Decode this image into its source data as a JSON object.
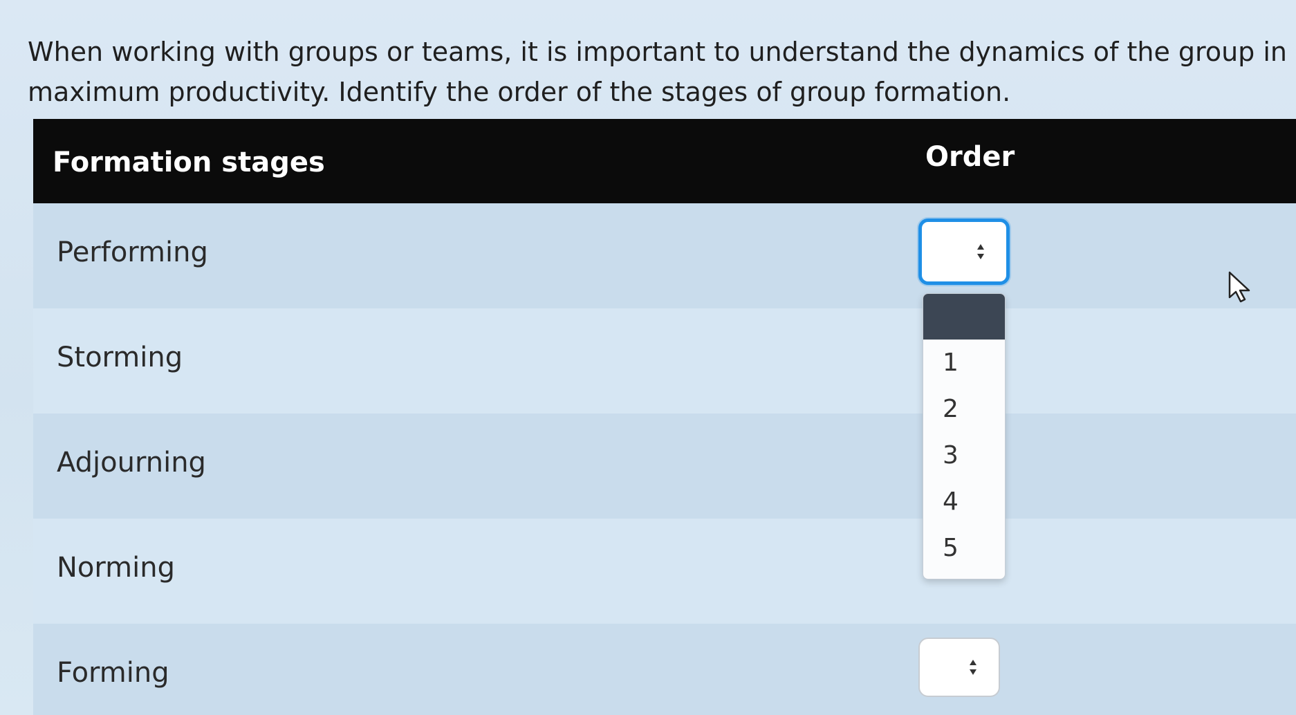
{
  "question": {
    "line1": "When working with groups or teams, it is important to understand the dynamics of the group in order to achieve",
    "line2": "maximum productivity. Identify the order of the stages of group formation."
  },
  "table": {
    "headers": {
      "stage": "Formation stages",
      "order": "Order"
    },
    "rows": [
      {
        "stage": "Performing"
      },
      {
        "stage": "Storming"
      },
      {
        "stage": "Adjourning"
      },
      {
        "stage": "Norming"
      },
      {
        "stage": "Forming"
      }
    ]
  },
  "dropdown": {
    "options": [
      "",
      "1",
      "2",
      "3",
      "4",
      "5"
    ]
  },
  "icons": {
    "select_arrows": "up-down-arrows-icon",
    "cursor": "mouse-pointer-icon"
  },
  "colors": {
    "header_bg": "#0b0b0b",
    "focus_ring": "#1f8fe6",
    "dropdown_selected": "#3c4654"
  }
}
